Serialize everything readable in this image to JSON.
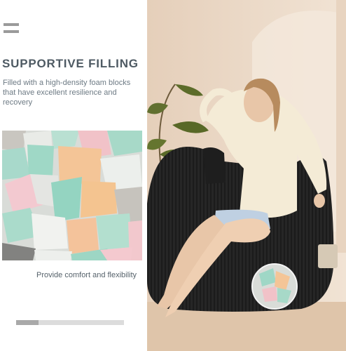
{
  "feature": {
    "title": "SUPPORTIVE FILLING",
    "description": "Filled with a high-density foam blocks that have excellent resilience and recovery",
    "caption": "Provide comfort and flexibility"
  },
  "carousel": {
    "progress": 0.21
  },
  "icons": [
    "menu-icon"
  ],
  "colors": {
    "title_text": "#4e5a63",
    "body_text": "#6d7a84",
    "bean_bag": "#262626",
    "wall": "#eddcc8",
    "foam_green": "#9fd7c6",
    "foam_pink": "#f0c5c9",
    "foam_orange": "#f4c59a"
  }
}
